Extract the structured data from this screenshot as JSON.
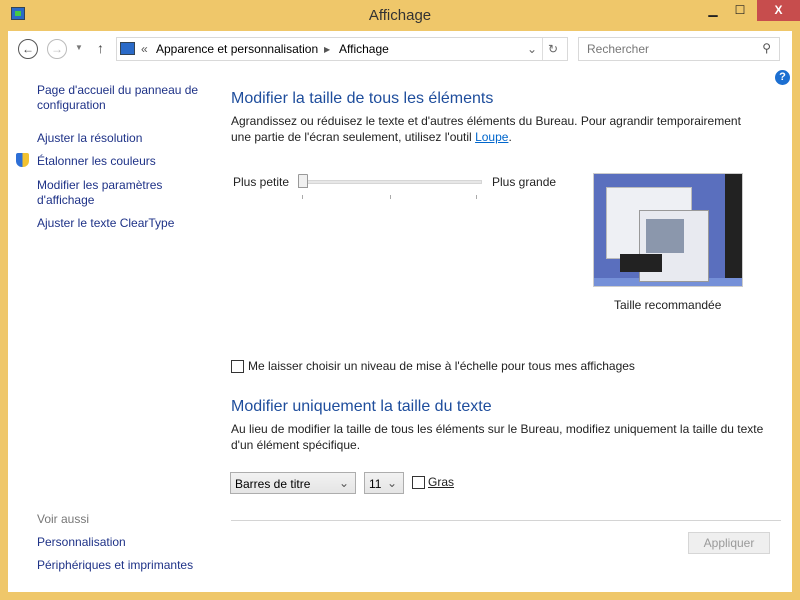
{
  "window": {
    "title": "Affichage",
    "close": "X"
  },
  "address": {
    "overflow": "«",
    "crumbs": [
      "Apparence et personnalisation",
      "Affichage"
    ]
  },
  "search": {
    "placeholder": "Rechercher"
  },
  "sidebar": {
    "items": [
      "Page d'accueil du panneau de configuration",
      "Ajuster la résolution",
      "Étalonner les couleurs",
      "Modifier les paramètres d'affichage",
      "Ajuster le texte ClearType"
    ],
    "see_also": "Voir aussi",
    "see_also_items": [
      "Personnalisation",
      "Périphériques et imprimantes"
    ]
  },
  "section1": {
    "title": "Modifier la taille de tous les éléments",
    "desc": "Agrandissez ou réduisez le texte et d'autres éléments du Bureau. Pour agrandir temporairement une partie de l'écran seulement, utilisez l'outil ",
    "link": "Loupe",
    "after": ".",
    "slider_min": "Plus petite",
    "slider_max": "Plus grande",
    "slider_value": 0,
    "preview_caption": "Taille recommandée",
    "checkbox": "Me laisser choisir un niveau de mise à l'échelle pour tous mes affichages"
  },
  "section2": {
    "title": "Modifier uniquement la taille du texte",
    "desc": "Au lieu de modifier la taille de tous les éléments sur le Bureau, modifiez uniquement la taille du texte d'un élément spécifique.",
    "element": "Barres de titre",
    "size": "11",
    "bold": "Gras"
  },
  "apply": "Appliquer"
}
